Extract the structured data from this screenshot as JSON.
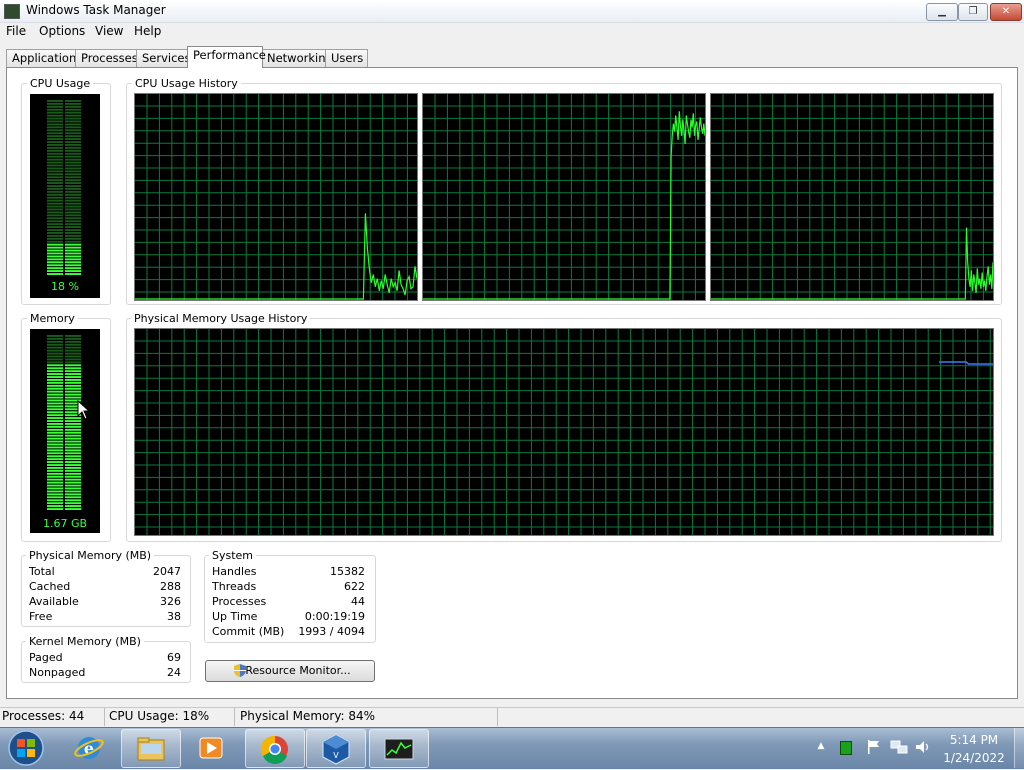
{
  "window": {
    "title": "Windows Task Manager",
    "buttons": {
      "minimize": "▁",
      "maximize": "❐",
      "close": "✕"
    }
  },
  "menu": [
    "File",
    "Options",
    "View",
    "Help"
  ],
  "tabs": [
    {
      "label": "Applications",
      "active": false
    },
    {
      "label": "Processes",
      "active": false
    },
    {
      "label": "Services",
      "active": false
    },
    {
      "label": "Performance",
      "active": true
    },
    {
      "label": "Networking",
      "active": false
    },
    {
      "label": "Users",
      "active": false
    }
  ],
  "performance": {
    "cpu_usage": {
      "label": "CPU Usage",
      "value_text": "18 %",
      "value": 18
    },
    "cpu_history": {
      "label": "CPU Usage History",
      "cores": [
        {
          "values": [
            0,
            0,
            0,
            0,
            0,
            0,
            0,
            0,
            0,
            0,
            0,
            0,
            0,
            0,
            0,
            0,
            0,
            0,
            0,
            0,
            0,
            0,
            0,
            0,
            0,
            0,
            0,
            0,
            0,
            0,
            0,
            0,
            0,
            0,
            0,
            0,
            0,
            0,
            0,
            0,
            0,
            0,
            0,
            0,
            0,
            0,
            0,
            0,
            0,
            0,
            0,
            0,
            0,
            0,
            0,
            0,
            0,
            0,
            0,
            0,
            0,
            0,
            0,
            0,
            0,
            0,
            0,
            0,
            0,
            0,
            0,
            0,
            0,
            0,
            0,
            0,
            0,
            0,
            0,
            0,
            0,
            0,
            0,
            0,
            0,
            0,
            0,
            0,
            0,
            0,
            0,
            0,
            0,
            0,
            0,
            0,
            0,
            0,
            0,
            0,
            0,
            0,
            0,
            0,
            0,
            0,
            0,
            0,
            0,
            0,
            0,
            0,
            0,
            0,
            0,
            0,
            42,
            25,
            15,
            8,
            12,
            6,
            10,
            4,
            9,
            5,
            12,
            7,
            3,
            10,
            6,
            8,
            4,
            14,
            7,
            5,
            2,
            9,
            11,
            5,
            6,
            16,
            10
          ]
        },
        {
          "values": [
            0,
            0,
            0,
            0,
            0,
            0,
            0,
            0,
            0,
            0,
            0,
            0,
            0,
            0,
            0,
            0,
            0,
            0,
            0,
            0,
            0,
            0,
            0,
            0,
            0,
            0,
            0,
            0,
            0,
            0,
            0,
            0,
            0,
            0,
            0,
            0,
            0,
            0,
            0,
            0,
            0,
            0,
            0,
            0,
            0,
            0,
            0,
            0,
            0,
            0,
            0,
            0,
            0,
            0,
            0,
            0,
            0,
            0,
            0,
            0,
            0,
            0,
            0,
            0,
            0,
            0,
            0,
            0,
            0,
            0,
            0,
            0,
            0,
            0,
            0,
            0,
            0,
            0,
            0,
            0,
            0,
            0,
            0,
            0,
            0,
            0,
            0,
            0,
            0,
            0,
            0,
            0,
            0,
            0,
            0,
            0,
            0,
            0,
            0,
            0,
            0,
            0,
            0,
            0,
            0,
            0,
            0,
            0,
            0,
            0,
            0,
            0,
            0,
            0,
            0,
            0,
            0,
            0,
            0,
            0,
            0,
            0,
            0,
            0,
            0,
            0,
            0,
            0,
            0,
            0,
            0,
            0,
            0,
            0,
            0,
            0,
            0,
            0,
            0,
            0,
            0,
            0,
            0,
            0,
            0,
            0,
            0,
            0,
            0,
            0,
            0,
            0,
            0,
            0,
            0,
            0,
            0,
            0,
            0,
            0,
            0,
            0,
            0,
            0,
            0,
            0,
            0,
            0,
            0,
            0,
            0,
            0,
            0,
            0,
            0,
            0,
            0,
            0,
            0,
            0,
            0,
            0,
            0,
            0,
            0,
            0,
            0,
            0,
            0,
            0,
            0,
            0,
            0,
            0,
            0,
            0,
            0,
            0,
            0,
            0,
            0,
            0,
            0,
            0,
            0,
            0,
            0,
            0,
            0,
            0,
            0,
            0,
            70,
            80,
            86,
            82,
            90,
            84,
            78,
            92,
            85,
            80,
            88,
            83,
            76,
            90,
            86,
            82,
            79,
            88,
            84,
            91,
            80,
            85,
            87,
            78,
            83,
            89,
            84,
            81,
            86,
            80
          ]
        },
        {
          "values": [
            0,
            0,
            0,
            0,
            0,
            0,
            0,
            0,
            0,
            0,
            0,
            0,
            0,
            0,
            0,
            0,
            0,
            0,
            0,
            0,
            0,
            0,
            0,
            0,
            0,
            0,
            0,
            0,
            0,
            0,
            0,
            0,
            0,
            0,
            0,
            0,
            0,
            0,
            0,
            0,
            0,
            0,
            0,
            0,
            0,
            0,
            0,
            0,
            0,
            0,
            0,
            0,
            0,
            0,
            0,
            0,
            0,
            0,
            0,
            0,
            0,
            0,
            0,
            0,
            0,
            0,
            0,
            0,
            0,
            0,
            0,
            0,
            0,
            0,
            0,
            0,
            0,
            0,
            0,
            0,
            0,
            0,
            0,
            0,
            0,
            0,
            0,
            0,
            0,
            0,
            0,
            0,
            0,
            0,
            0,
            0,
            0,
            0,
            0,
            0,
            0,
            0,
            0,
            0,
            0,
            0,
            0,
            0,
            0,
            0,
            0,
            0,
            0,
            0,
            0,
            0,
            0,
            0,
            0,
            0,
            0,
            0,
            0,
            0,
            0,
            0,
            0,
            0,
            0,
            0,
            0,
            0,
            0,
            0,
            0,
            0,
            0,
            0,
            0,
            0,
            0,
            0,
            0,
            0,
            0,
            0,
            0,
            0,
            0,
            0,
            0,
            0,
            0,
            0,
            0,
            0,
            0,
            0,
            0,
            0,
            0,
            0,
            0,
            0,
            0,
            0,
            0,
            0,
            0,
            0,
            0,
            0,
            0,
            0,
            0,
            0,
            0,
            0,
            0,
            0,
            0,
            0,
            0,
            0,
            0,
            0,
            0,
            0,
            0,
            0,
            0,
            0,
            0,
            0,
            0,
            0,
            0,
            0,
            0,
            0,
            0,
            0,
            0,
            0,
            0,
            0,
            0,
            0,
            0,
            0,
            0,
            0,
            35,
            18,
            10,
            6,
            14,
            4,
            12,
            8,
            3,
            15,
            7,
            10,
            5,
            13,
            6,
            9,
            4,
            11,
            16,
            7,
            12,
            5,
            18
          ]
        }
      ]
    },
    "memory": {
      "label": "Memory",
      "value_text": "1.67 GB",
      "fraction": 0.84
    },
    "memory_history": {
      "label": "Physical Memory Usage History",
      "values": [
        84,
        84,
        84,
        84,
        84,
        84,
        84,
        84,
        84,
        84,
        84,
        84,
        83,
        83,
        83,
        83,
        83,
        83,
        83,
        83,
        83,
        83,
        83
      ]
    },
    "colors": {
      "graph_line": "#2bff2b",
      "grid": "#0b7a3f",
      "memory_line": "#3c7bff",
      "meter_on": "#3dff3d",
      "meter_off": "#1a5a1a"
    }
  },
  "physical_memory": {
    "label": "Physical Memory (MB)",
    "rows": [
      {
        "name": "Total",
        "value": "2047"
      },
      {
        "name": "Cached",
        "value": "288"
      },
      {
        "name": "Available",
        "value": "326"
      },
      {
        "name": "Free",
        "value": "38"
      }
    ]
  },
  "kernel_memory": {
    "label": "Kernel Memory (MB)",
    "rows": [
      {
        "name": "Paged",
        "value": "69"
      },
      {
        "name": "Nonpaged",
        "value": "24"
      }
    ]
  },
  "system": {
    "label": "System",
    "rows": [
      {
        "name": "Handles",
        "value": "15382"
      },
      {
        "name": "Threads",
        "value": "622"
      },
      {
        "name": "Processes",
        "value": "44"
      },
      {
        "name": "Up Time",
        "value": "0:00:19:19"
      },
      {
        "name": "Commit (MB)",
        "value": "1993 / 4094"
      }
    ]
  },
  "resource_monitor_button": "Resource Monitor...",
  "statusbar": {
    "processes": "Processes: 44",
    "cpu": "CPU Usage: 18%",
    "memory": "Physical Memory: 84%"
  },
  "taskbar": {
    "time": "5:14 PM",
    "date": "1/24/2022",
    "items": [
      "start-orb",
      "internet-explorer-icon",
      "file-explorer-icon",
      "media-player-icon",
      "chrome-icon",
      "virtualbox-icon",
      "task-manager-icon"
    ]
  }
}
